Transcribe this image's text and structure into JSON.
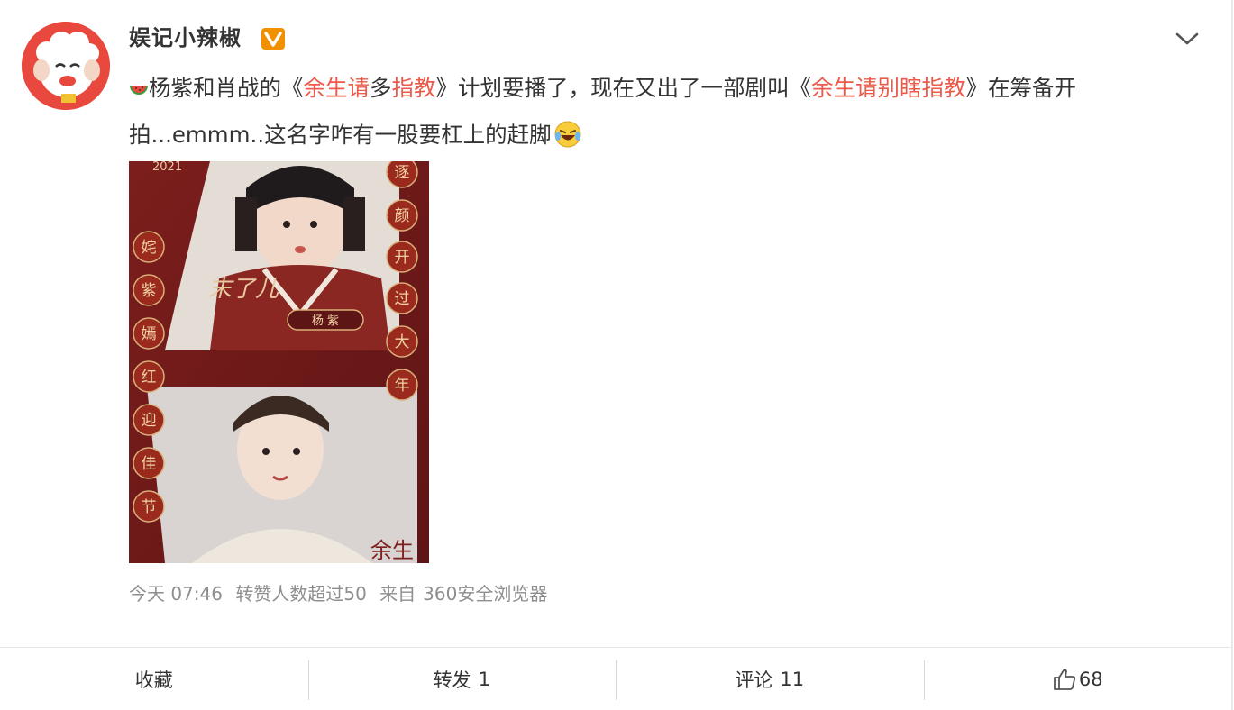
{
  "post": {
    "username": "娱记小辣椒",
    "content": {
      "seg1": "杨紫和肖战的《",
      "topic1a": "余生请",
      "seg2": "多",
      "topic1b": "指教",
      "seg3": "》计划要播了，现在又出了一部剧叫《",
      "topic2": "余生请别瞎指教",
      "seg4": "》在筹备开拍...emmm..这名字咋有一股要杠上的赶脚"
    },
    "image": {
      "year": "2021",
      "left_banner": [
        "姹",
        "紫",
        "嫣",
        "红",
        "迎",
        "佳",
        "节"
      ],
      "right_banner": [
        "逐",
        "颜",
        "开",
        "过",
        "大",
        "年"
      ],
      "name_tag": "杨 紫",
      "signature": "末了儿",
      "corner_text": "余生"
    },
    "meta": {
      "time": "今天 07:46",
      "reposts_note": "转赞人数超过50",
      "source_prefix": "来自",
      "source": "360安全浏览器"
    },
    "actions": {
      "favorite": "收藏",
      "repost_label": "转发",
      "repost_count": "1",
      "comment_label": "评论",
      "comment_count": "11",
      "like_count": "68"
    }
  },
  "colors": {
    "topic": "#eb5a4a",
    "meta": "#8e8e8e",
    "badge": "#f29100",
    "banner": "#9b2a1e"
  }
}
